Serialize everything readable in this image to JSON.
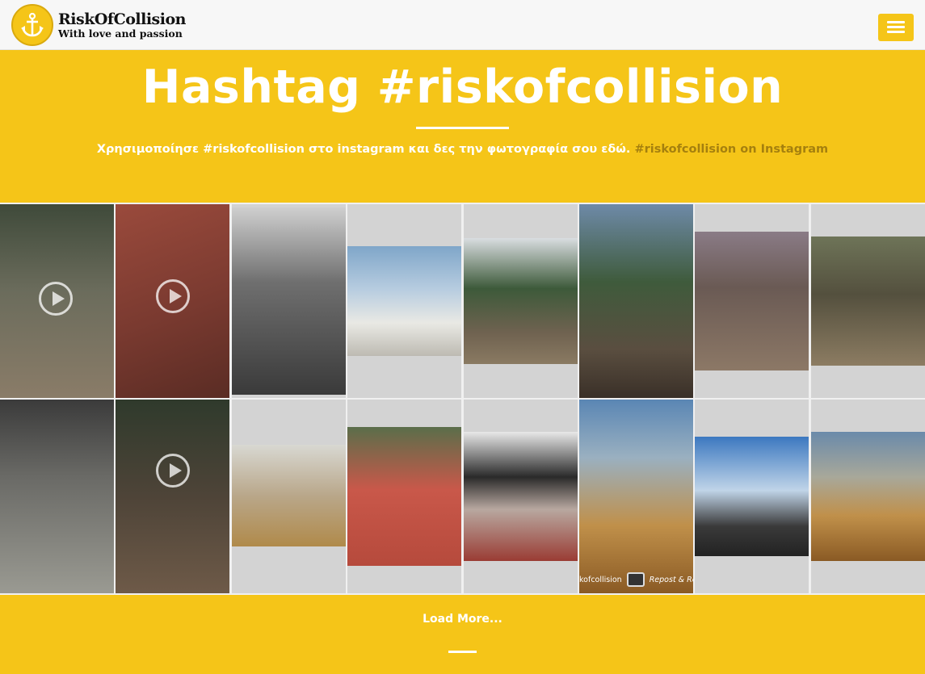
{
  "header": {
    "logo": {
      "icon": "anchor-icon",
      "title": "RiskOfCollision",
      "tagline": "With love and passion"
    },
    "menu_icon": "hamburger-menu-icon"
  },
  "hero": {
    "title": "Hashtag #riskofcollision",
    "subtitle_text": "Χρησιμοποίησε #riskofcollision στο instagram και δες την φωτογραφία σου εδώ.",
    "subtitle_link": "#riskofcollision on Instagram"
  },
  "gallery": {
    "watermark_user": "kofcollision",
    "watermark_app": "Repost & Re",
    "tiles": [
      {
        "scene": "bmx rider in pine forest",
        "video": true
      },
      {
        "scene": "red bowl close-up",
        "video": true
      },
      {
        "scene": "black and white jump over hut",
        "video": false
      },
      {
        "scene": "rider on church dome",
        "video": false
      },
      {
        "scene": "rider over dirt jumps in pines",
        "video": false
      },
      {
        "scene": "rider high over dirt jump",
        "video": false
      },
      {
        "scene": "rider in pump track",
        "video": false
      },
      {
        "scene": "rider on dirt lip",
        "video": false
      },
      {
        "scene": "rider upside down indoor ramp",
        "video": false
      },
      {
        "scene": "rider in forest dusk",
        "video": true
      },
      {
        "scene": "couple at dirt jumps",
        "video": false
      },
      {
        "scene": "red skate bowl",
        "video": false
      },
      {
        "scene": "rider over balcony",
        "video": false
      },
      {
        "scene": "dirt jumps at sunset",
        "video": false
      },
      {
        "scene": "rider helmet selfie",
        "video": false
      },
      {
        "scene": "dirt jumps sunset view",
        "video": false
      }
    ]
  },
  "footer": {
    "load_more": "Load More..."
  },
  "colors": {
    "accent": "#f5c518",
    "header_bg": "#f7f7f7",
    "text": "#ffffff"
  }
}
